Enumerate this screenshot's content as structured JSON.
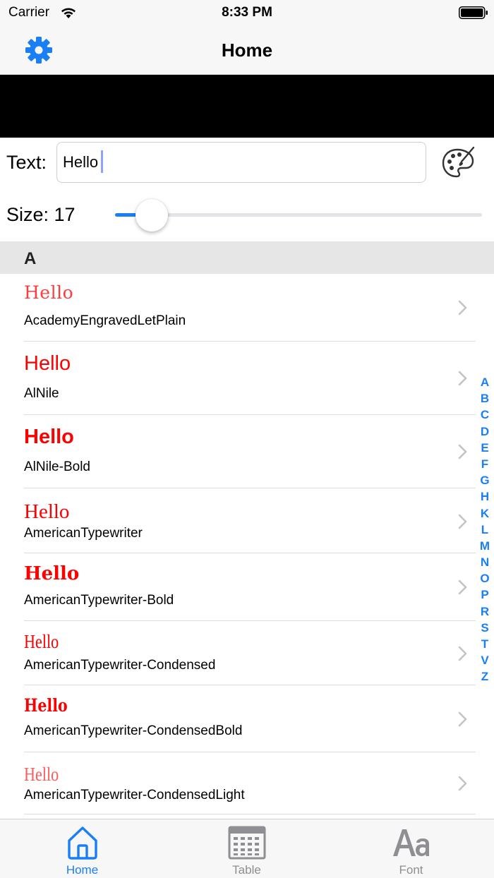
{
  "status": {
    "carrier": "Carrier",
    "time": "8:33 PM"
  },
  "nav": {
    "title": "Home"
  },
  "controls": {
    "text_label": "Text:",
    "text_value": "Hello",
    "size_label": "Size: 17",
    "size_fraction": 0.1
  },
  "section": {
    "letter": "A"
  },
  "fonts": [
    {
      "sample": "Hello",
      "name": "AcademyEngravedLetPlain"
    },
    {
      "sample": "Hello",
      "name": "AlNile"
    },
    {
      "sample": "Hello",
      "name": "AlNile-Bold"
    },
    {
      "sample": "Hello",
      "name": "AmericanTypewriter"
    },
    {
      "sample": "Hello",
      "name": "AmericanTypewriter-Bold"
    },
    {
      "sample": "Hello",
      "name": "AmericanTypewriter-Condensed"
    },
    {
      "sample": "Hello",
      "name": "AmericanTypewriter-CondensedBold"
    },
    {
      "sample": "Hello",
      "name": "AmericanTypewriter-CondensedLight"
    }
  ],
  "index_letters": [
    "A",
    "B",
    "C",
    "D",
    "E",
    "F",
    "G",
    "H",
    "K",
    "L",
    "M",
    "N",
    "O",
    "P",
    "R",
    "S",
    "T",
    "V",
    "Z"
  ],
  "tabs": [
    {
      "label": "Home",
      "active": true
    },
    {
      "label": "Table",
      "active": false
    },
    {
      "label": "Font",
      "active": false
    }
  ],
  "colors": {
    "accent": "#1a7ff5",
    "sample_text": "#ff0000",
    "inactive_tab": "#8e8e93"
  }
}
